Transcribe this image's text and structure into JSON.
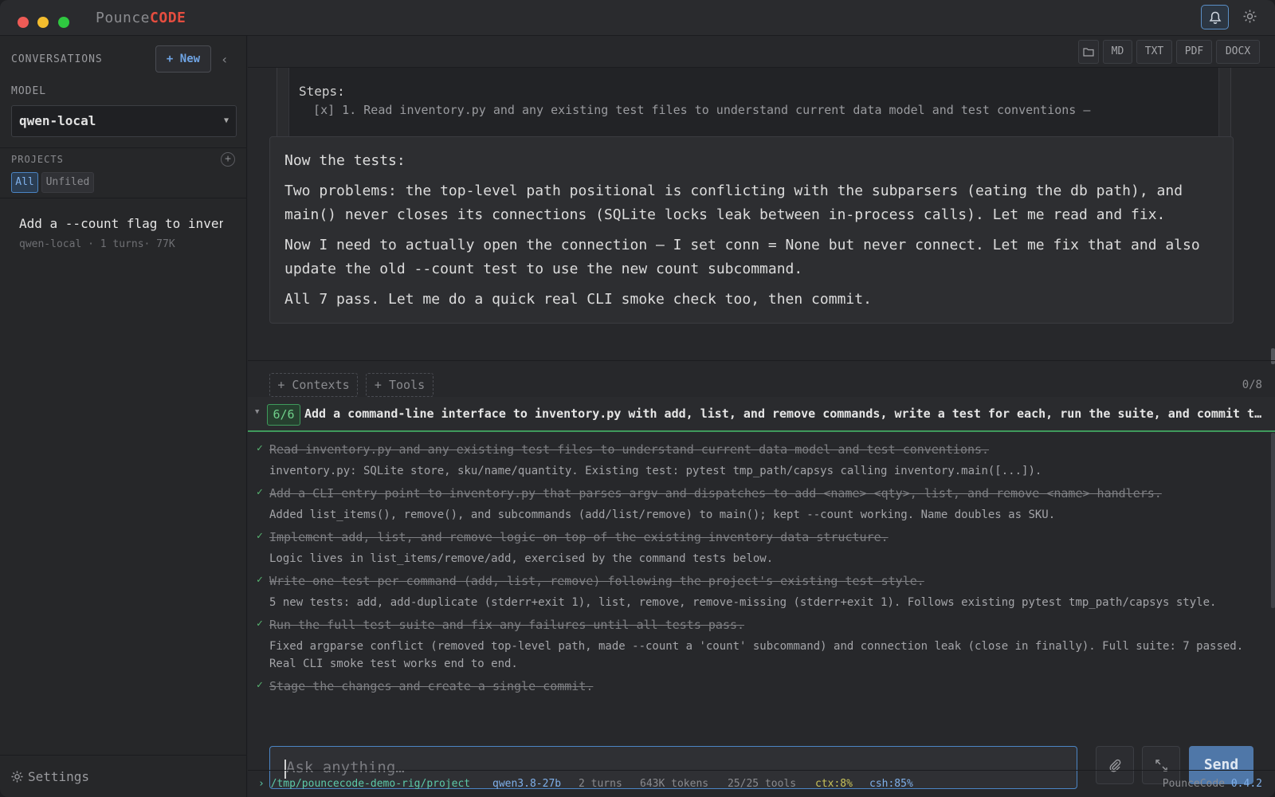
{
  "app": {
    "brand_a": "Pounce",
    "brand_b": "CODE"
  },
  "sidebar": {
    "conversations_heading": "CONVERSATIONS",
    "new_label": "+ New",
    "model_heading": "MODEL",
    "model_value": "qwen-local",
    "projects_heading": "PROJECTS",
    "filters": [
      "All",
      "Unfiled"
    ],
    "conversation": {
      "title": "Add a --count flag to inventory.py",
      "meta": "qwen-local · 1 turns· 77K"
    },
    "settings_label": "Settings"
  },
  "toolbar": {
    "export": [
      "MD",
      "TXT",
      "PDF",
      "DOCX"
    ]
  },
  "previous": {
    "label": "Steps:",
    "step": "  [x] 1. Read inventory.py and any existing test files to understand current data model and test conventions — "
  },
  "message": {
    "p1": "Now the tests:",
    "p2": "Two problems: the top-level path positional is conflicting with the subparsers (eating the db path), and main() never closes its connections (SQLite locks leak between in-process calls). Let me read and fix.",
    "p3": "Now I need to actually open the connection — I set conn = None but never connect. Let me fix that and also update the old --count test to use the new count subcommand.",
    "p4": "All 7 pass. Let me do a quick real CLI smoke check too, then commit."
  },
  "context_bar": {
    "contexts": "+ Contexts",
    "tools": "+ Tools",
    "count": "0/8"
  },
  "plan": {
    "progress": "6/6",
    "title": "Add a command-line interface to inventory.py with add, list, and remove commands, write a test for each, run the suite, and commit the changes",
    "steps": [
      {
        "title": "Read inventory.py and any existing test files to understand current data model and test conventions.",
        "note": "inventory.py: SQLite store, sku/name/quantity. Existing test: pytest tmp_path/capsys calling inventory.main([...])."
      },
      {
        "title": "Add a CLI entry point to inventory.py that parses argv and dispatches to add <name> <qty>, list, and remove <name> handlers.",
        "note": "Added list_items(), remove(), and subcommands (add/list/remove) to main(); kept --count working. Name doubles as SKU."
      },
      {
        "title": "Implement add, list, and remove logic on top of the existing inventory data structure.",
        "note": "Logic lives in list_items/remove/add, exercised by the command tests below."
      },
      {
        "title": "Write one test per command (add, list, remove) following the project's existing test style.",
        "note": "5 new tests: add, add-duplicate (stderr+exit 1), list, remove, remove-missing (stderr+exit 1). Follows existing pytest tmp_path/capsys style."
      },
      {
        "title": "Run the full test suite and fix any failures until all tests pass.",
        "note": "Fixed argparse conflict (removed top-level path, made --count a 'count' subcommand) and connection leak (close in finally). Full suite: 7 passed. Real CLI smoke test works end to end."
      },
      {
        "title": "Stage the changes and create a single commit.",
        "note": ""
      }
    ]
  },
  "input": {
    "placeholder": "Ask anything…",
    "send": "Send"
  },
  "status": {
    "path": "/tmp/pouncecode-demo-rig/project",
    "model": "qwen3.8-27b",
    "turns": "2 turns",
    "tokens": "643K tokens",
    "tools": "25/25 tools",
    "ctx": "ctx:8%",
    "csh": "csh:85%",
    "version_label": "PounceCode",
    "version": "0.4.2"
  }
}
